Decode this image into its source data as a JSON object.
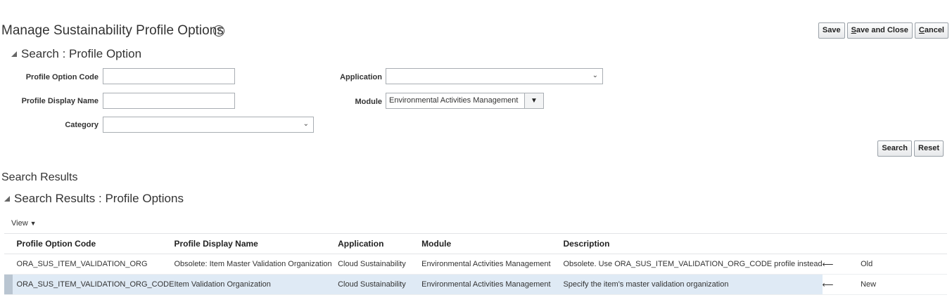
{
  "page": {
    "title": "Manage Sustainability Profile Options",
    "help_icon": "help-circle-icon",
    "buttons": {
      "save": "Save",
      "save_and_close_first": "S",
      "save_and_close_rest": "ave and Close",
      "cancel_first": "C",
      "cancel_rest": "ancel"
    }
  },
  "search": {
    "header": "Search : Profile Option",
    "fields": {
      "profile_option_code_label": "Profile Option Code",
      "profile_option_code_value": "",
      "profile_display_name_label": "Profile Display Name",
      "profile_display_name_value": "",
      "category_label": "Category",
      "category_value": "",
      "application_label": "Application",
      "application_value": "",
      "module_label": "Module",
      "module_value": "Environmental Activities Management"
    },
    "buttons": {
      "search": "Search",
      "reset": "Reset"
    }
  },
  "results": {
    "title": "Search Results",
    "header": "Search Results : Profile Options",
    "view_label": "View",
    "columns": {
      "code": "Profile Option Code",
      "name": "Profile Display Name",
      "application": "Application",
      "module": "Module",
      "description": "Description"
    },
    "rows": [
      {
        "code": "ORA_SUS_ITEM_VALIDATION_ORG",
        "name": "Obsolete: Item Master Validation Organization",
        "application": "Cloud Sustainability",
        "module": "Environmental Activities Management",
        "description": "Obsolete. Use ORA_SUS_ITEM_VALIDATION_ORG_CODE profile instead",
        "arrow": "⟵",
        "note": "Old"
      },
      {
        "code": "ORA_SUS_ITEM_VALIDATION_ORG_CODE",
        "name": "Item Validation Organization",
        "application": "Cloud Sustainability",
        "module": "Environmental Activities Management",
        "description": "Specify the item's master validation organization",
        "arrow": "⟵",
        "note": "New"
      }
    ]
  },
  "colors": {
    "old_note": "#d1271b",
    "new_note": "#3a7d28",
    "arrow": "#2a4fa8",
    "selected_row": "#dfeaf5"
  }
}
